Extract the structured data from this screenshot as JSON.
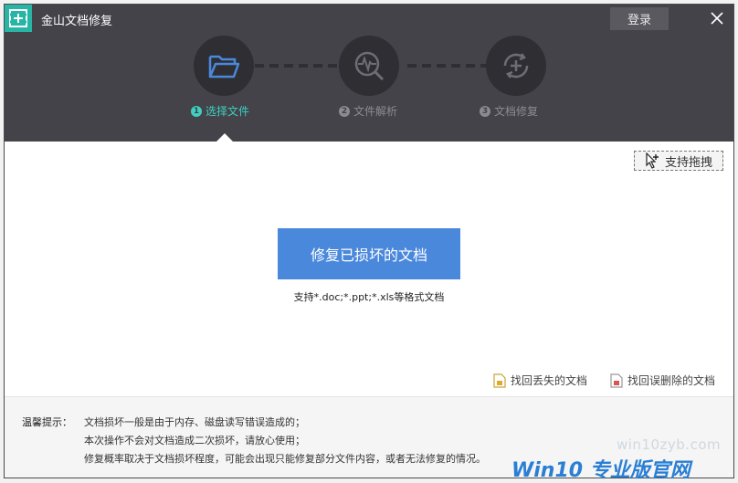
{
  "app": {
    "title": "金山文档修复",
    "login_label": "登录"
  },
  "steps": [
    {
      "num": "1",
      "label": "选择文件"
    },
    {
      "num": "2",
      "label": "文件解析"
    },
    {
      "num": "3",
      "label": "文档修复"
    }
  ],
  "drag": {
    "label": "支持拖拽"
  },
  "main": {
    "repair_button": "修复已损坏的文档",
    "support_formats": "支持*.doc;*.ppt;*.xls等格式文档"
  },
  "links": {
    "recover_lost": "找回丢失的文档",
    "recover_deleted": "找回误删除的文档"
  },
  "tips": {
    "title": "温馨提示：",
    "lines": [
      "文档损坏一般是由于内存、磁盘读写错误造成的；",
      "本次操作不会对文档造成二次损坏，请放心使用；",
      "修复概率取决于文档损坏程度，可能会出现只能修复部分文件内容，或者无法修复的情况。"
    ]
  },
  "watermark": {
    "site": "win10zyb.com",
    "brand": "Win10 专业版官网"
  },
  "colors": {
    "header_bg": "#44434a",
    "accent": "#3fd0bf",
    "button": "#4a88dc",
    "logo_bg": "#27b5a5"
  }
}
